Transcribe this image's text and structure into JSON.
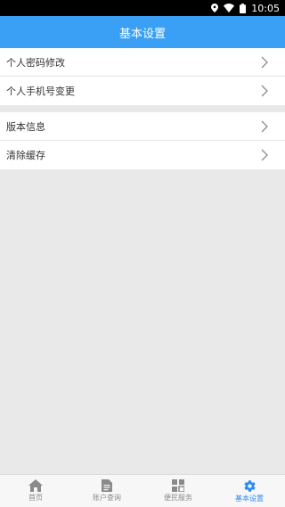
{
  "status_bar": {
    "time": "10:05",
    "icons": [
      "location-icon",
      "wifi-icon",
      "battery-icon"
    ]
  },
  "header": {
    "title": "基本设置",
    "color": "#3aa0f6"
  },
  "settings": {
    "group1": [
      {
        "label": "个人密码修改"
      },
      {
        "label": "个人手机号变更"
      }
    ],
    "group2": [
      {
        "label": "版本信息"
      },
      {
        "label": "清除缓存"
      }
    ]
  },
  "tabbar": {
    "active_color": "#2d8cf0",
    "tabs": [
      {
        "label": "首页",
        "icon": "home-icon"
      },
      {
        "label": "账户查询",
        "icon": "document-icon"
      },
      {
        "label": "便民服务",
        "icon": "grid-icon"
      },
      {
        "label": "基本设置",
        "icon": "gear-icon",
        "active": true
      }
    ]
  }
}
